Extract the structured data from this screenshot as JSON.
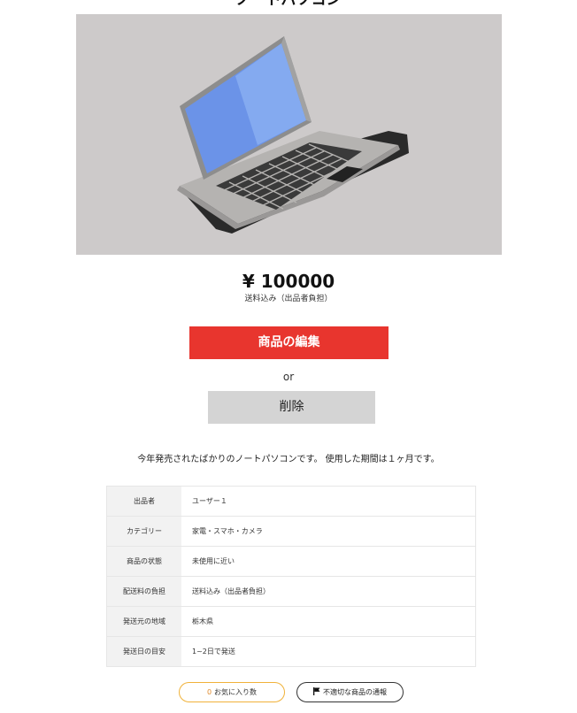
{
  "product": {
    "title": "ノートパソコン",
    "image_icon": "laptop-image",
    "price": "¥ 100000",
    "shipping_note": "送料込み（出品者負担）",
    "description": "今年発売されたばかりのノートパソコンです。 使用した期間は１ヶ月です。"
  },
  "actions": {
    "edit_label": "商品の編集",
    "or_label": "or",
    "delete_label": "削除",
    "edit_color": "#e8352e",
    "delete_color": "#d4d4d4"
  },
  "details": [
    {
      "label": "出品者",
      "value": "ユーザー１"
    },
    {
      "label": "カテゴリー",
      "value": "家電・スマホ・カメラ"
    },
    {
      "label": "商品の状態",
      "value": "未使用に近い"
    },
    {
      "label": "配送料の負担",
      "value": "送料込み（出品者負担）"
    },
    {
      "label": "発送元の地域",
      "value": "栃木県"
    },
    {
      "label": "発送日の目安",
      "value": "1~2日で発送"
    }
  ],
  "footer": {
    "favorite_count": "0",
    "favorite_label": "お気に入り数",
    "report_label": "不適切な商品の通報",
    "report_icon": "flag-icon",
    "favorite_border_color": "#f0b23a"
  }
}
